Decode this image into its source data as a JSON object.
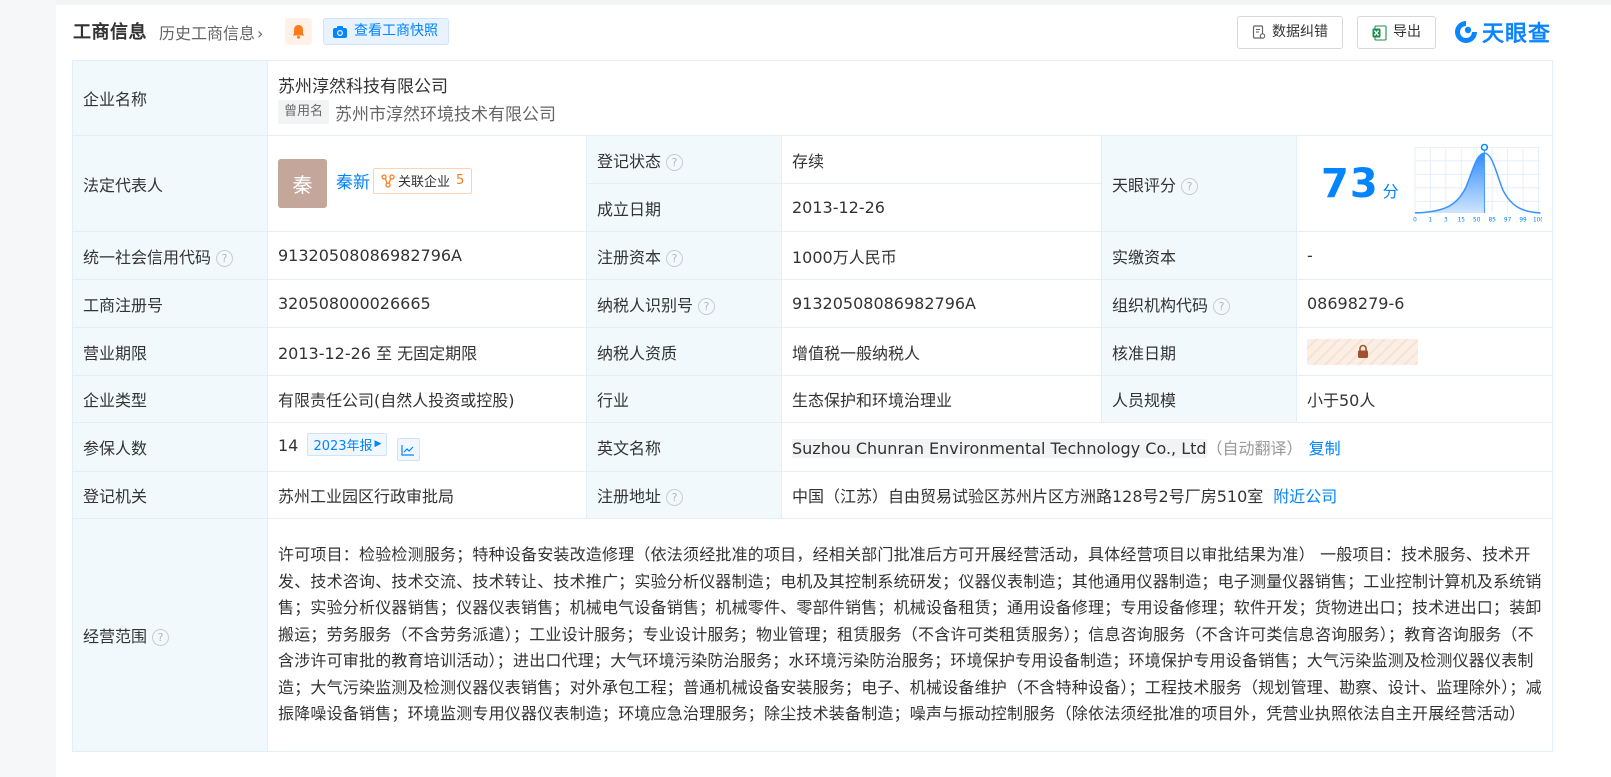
{
  "header": {
    "title": "工商信息",
    "history_link": "历史工商信息",
    "snapshot_button": "查看工商快照",
    "correct_button": "数据纠错",
    "export_button": "导出",
    "logo_text": "天眼查"
  },
  "colors": {
    "accent": "#0084ff",
    "status_green": "#1bb35a",
    "label_bg": "#f2f9fc",
    "orange": "#ff7a1a"
  },
  "company": {
    "label": "企业名称",
    "name": "苏州淳然科技有限公司",
    "used_name_tag": "曾用名",
    "used_name": "苏州市淳然环境技术有限公司"
  },
  "legal": {
    "label": "法定代表人",
    "avatar_char": "秦",
    "name": "秦新",
    "related_label": "关联企业",
    "related_count": "5"
  },
  "reg_status": {
    "label": "登记状态",
    "value": "存续"
  },
  "found_date": {
    "label": "成立日期",
    "value": "2013-12-26"
  },
  "score": {
    "label": "天眼评分",
    "value": "73",
    "unit": "分",
    "axis_ticks": [
      "0",
      "1",
      "3",
      "15",
      "50",
      "85",
      "97",
      "99",
      "100"
    ]
  },
  "credit_code": {
    "label": "统一社会信用代码",
    "value": "91320508086982796A"
  },
  "reg_capital": {
    "label": "注册资本",
    "value": "1000万人民币"
  },
  "paid_capital": {
    "label": "实缴资本",
    "value": "-"
  },
  "reg_no": {
    "label": "工商注册号",
    "value": "320508000026665"
  },
  "taxpayer_id": {
    "label": "纳税人识别号",
    "value": "91320508086982796A"
  },
  "org_code": {
    "label": "组织机构代码",
    "value": "08698279-6"
  },
  "term": {
    "label": "营业期限",
    "value": "2013-12-26 至 无固定期限"
  },
  "taxpayer_qual": {
    "label": "纳税人资质",
    "value": "增值税一般纳税人"
  },
  "approve_date": {
    "label": "核准日期"
  },
  "company_type": {
    "label": "企业类型",
    "value": "有限责任公司(自然人投资或控股)"
  },
  "industry": {
    "label": "行业",
    "value": "生态保护和环境治理业"
  },
  "staff_size": {
    "label": "人员规模",
    "value": "小于50人"
  },
  "insured": {
    "label": "参保人数",
    "value": "14",
    "report_tag": "2023年报"
  },
  "english_name": {
    "label": "英文名称",
    "value": "Suzhou Chunran Environmental Technology Co., Ltd",
    "auto_translate": "（自动翻译）",
    "copy": "复制"
  },
  "authority": {
    "label": "登记机关",
    "value": "苏州工业园区行政审批局"
  },
  "address": {
    "label": "注册地址",
    "value": "中国（江苏）自由贸易试验区苏州片区方洲路128号2号厂房510室",
    "nearby": "附近公司"
  },
  "scope": {
    "label": "经营范围",
    "value": "许可项目：检验检测服务；特种设备安装改造修理（依法须经批准的项目，经相关部门批准后方可开展经营活动，具体经营项目以审批结果为准） 一般项目：技术服务、技术开发、技术咨询、技术交流、技术转让、技术推广；实验分析仪器制造；电机及其控制系统研发；仪器仪表制造；其他通用仪器制造；电子测量仪器销售；工业控制计算机及系统销售；实验分析仪器销售；仪器仪表销售；机械电气设备销售；机械零件、零部件销售；机械设备租赁；通用设备修理；专用设备修理；软件开发；货物进出口；技术进出口；装卸搬运；劳务服务（不含劳务派遣）；工业设计服务；专业设计服务；物业管理；租赁服务（不含许可类租赁服务）；信息咨询服务（不含许可类信息咨询服务）；教育咨询服务（不含涉许可审批的教育培训活动）；进出口代理；大气环境污染防治服务；水环境污染防治服务；环境保护专用设备制造；环境保护专用设备销售；大气污染监测及检测仪器仪表制造；大气污染监测及检测仪器仪表销售；对外承包工程；普通机械设备安装服务；电子、机械设备维护（不含特种设备）；工程技术服务（规划管理、勘察、设计、监理除外）；减振降噪设备销售；环境监测专用仪器仪表制造；环境应急治理服务；除尘技术装备制造；噪声与振动控制服务（除依法须经批准的项目外，凭营业执照依法自主开展经营活动）"
  }
}
